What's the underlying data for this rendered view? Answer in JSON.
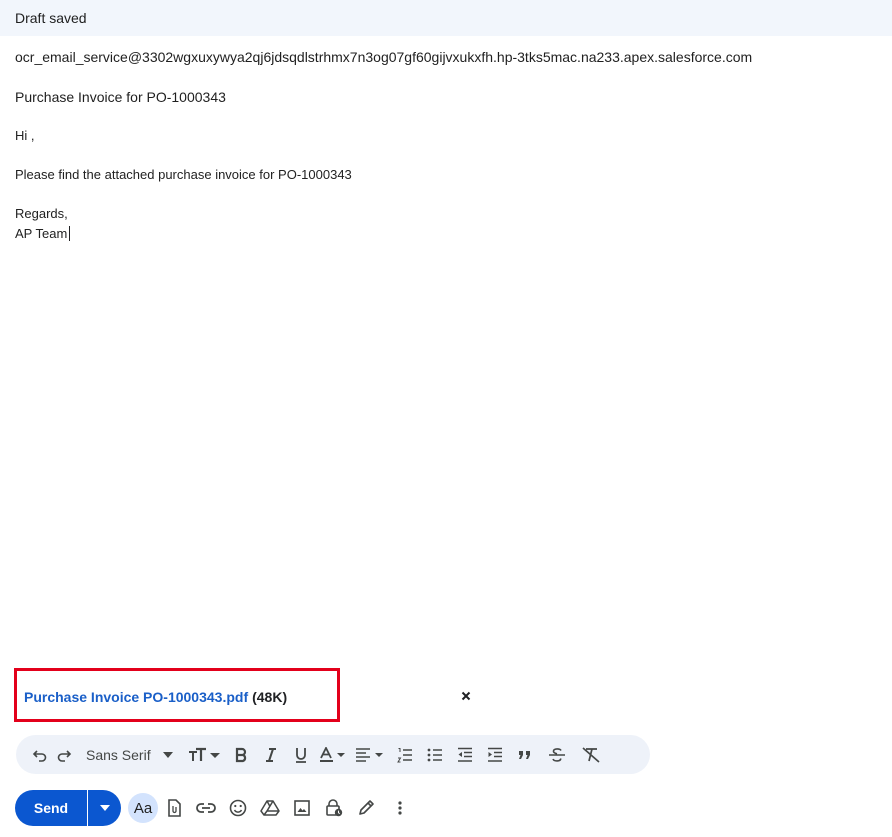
{
  "header": {
    "title": "Draft saved"
  },
  "compose": {
    "recipient": "ocr_email_service@3302wgxuxywya2qj6jdsqdlstrhmx7n3og07gf60gijvxukxfh.hp-3tks5mac.na233.apex.salesforce.com",
    "subject": "Purchase Invoice for PO-1000343",
    "body": {
      "greeting": "Hi ,",
      "line1": "Please find the attached purchase invoice for PO-1000343",
      "closing": "Regards,",
      "signature": "AP Team"
    }
  },
  "attachment": {
    "name": "Purchase Invoice PO-1000343.pdf",
    "size": "(48K)",
    "highlight_color": "#e3001b",
    "link_color": "#1a5fc8"
  },
  "formatting_toolbar": {
    "font": "Sans Serif",
    "icons": [
      "undo-icon",
      "redo-icon",
      "font-size-icon",
      "bold-icon",
      "italic-icon",
      "underline-icon",
      "text-color-icon",
      "align-icon",
      "numbered-list-icon",
      "bulleted-list-icon",
      "indent-less-icon",
      "indent-more-icon",
      "quote-icon",
      "strikethrough-icon",
      "remove-formatting-icon"
    ]
  },
  "send_bar": {
    "send_label": "Send",
    "format_toggle_label": "Aa",
    "accent_color": "#0b57d0",
    "icons": [
      "attach-file-icon",
      "insert-link-icon",
      "emoji-icon",
      "drive-icon",
      "insert-photo-icon",
      "confidential-mode-icon",
      "signature-icon",
      "more-options-icon"
    ]
  }
}
